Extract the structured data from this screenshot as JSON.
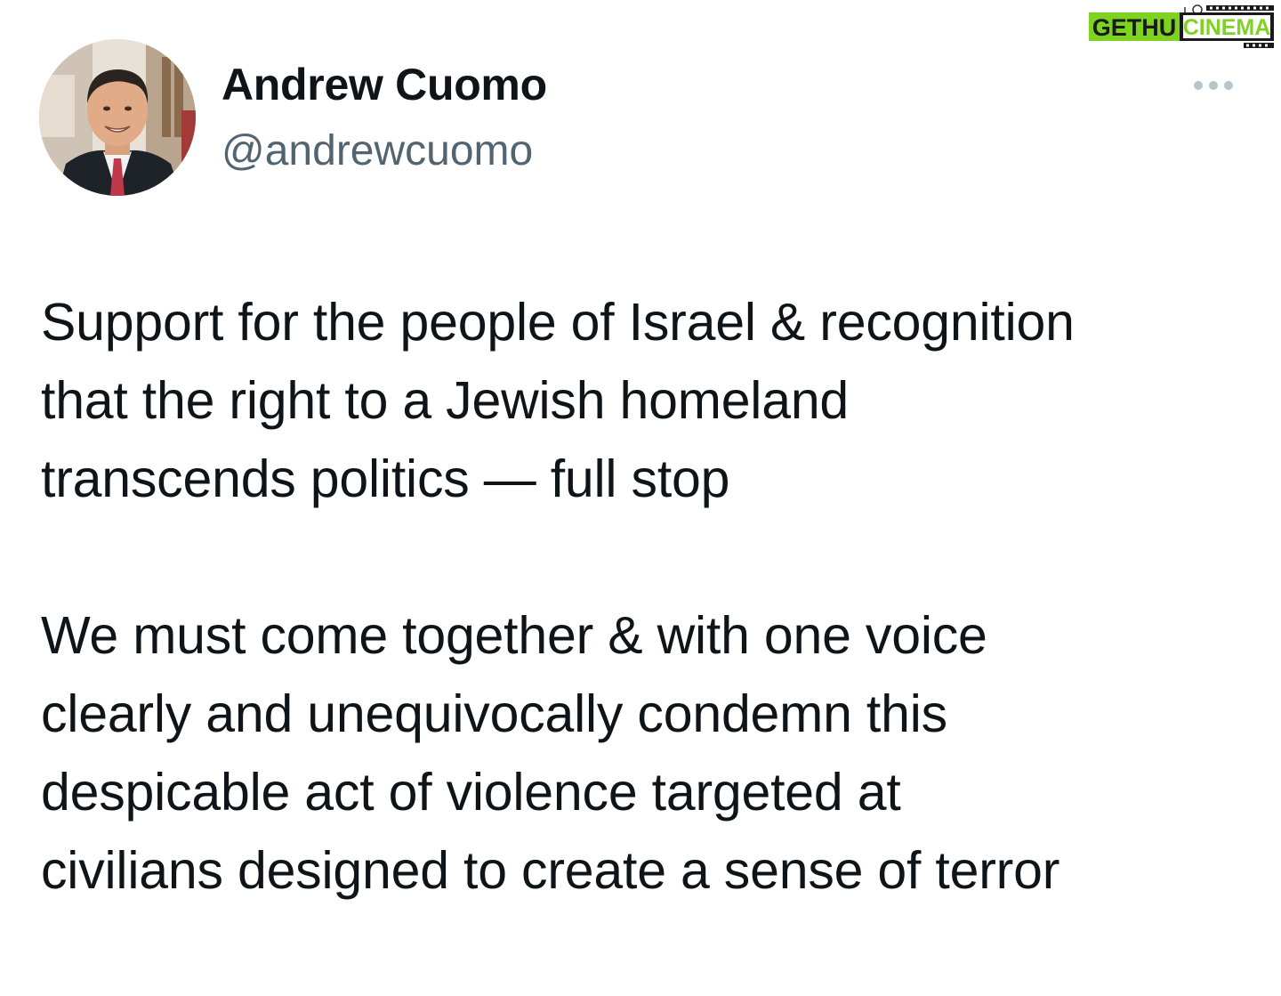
{
  "tweet": {
    "author": {
      "name": "Andrew Cuomo",
      "handle": "@andrewcuomo",
      "avatar_icon": "profile-photo"
    },
    "more_icon": "more-horizontal-icon",
    "paragraphs": [
      "Support for the people of Israel & recognition\nthat the right to a Jewish homeland\ntranscends politics — full stop",
      "We must come together & with one voice\nclearly and unequivocally condemn this\ndespicable act of violence targeted at\ncivilians designed to create a sense of terror"
    ]
  },
  "watermark": {
    "text_left": "GETHU",
    "text_right": "CINEMA",
    "colors": {
      "background": "#7ed321",
      "left_text": "#1a1a1a",
      "right_text": "#7ed321"
    }
  },
  "colors": {
    "text_primary": "#0f1419",
    "text_secondary": "#536471",
    "more_dots": "#b9c3cc"
  }
}
